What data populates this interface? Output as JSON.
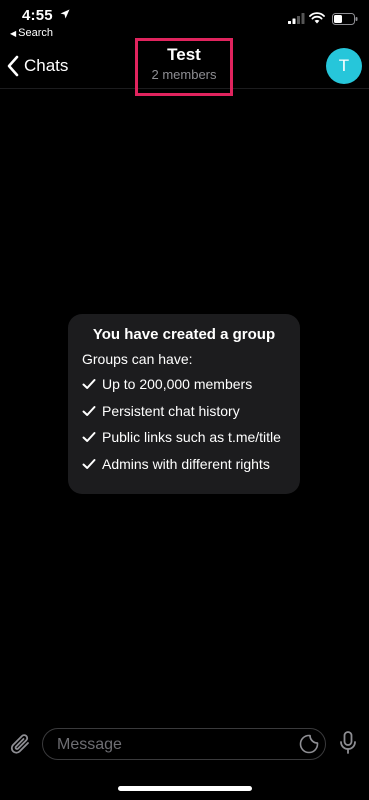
{
  "status_bar": {
    "time": "4:55",
    "back_app_label": "Search"
  },
  "nav": {
    "back_label": "Chats",
    "title": "Test",
    "subtitle": "2 members",
    "avatar_initial": "T",
    "avatar_color": "#26c6da",
    "highlight_color": "#e0245e"
  },
  "info_card": {
    "title": "You have created a group",
    "subtitle": "Groups can have:",
    "features": [
      "Up to 200,000 members",
      "Persistent chat history",
      "Public links such as t.me/title",
      "Admins with different rights"
    ]
  },
  "composer": {
    "placeholder": "Message"
  },
  "icons": {
    "location": "location-arrow-icon",
    "signal": "cellular-signal-icon",
    "wifi": "wifi-icon",
    "battery": "battery-icon",
    "back": "chevron-left-icon",
    "attach": "paperclip-icon",
    "sticker": "sticker-icon",
    "mic": "microphone-icon",
    "check": "checkmark-icon"
  }
}
